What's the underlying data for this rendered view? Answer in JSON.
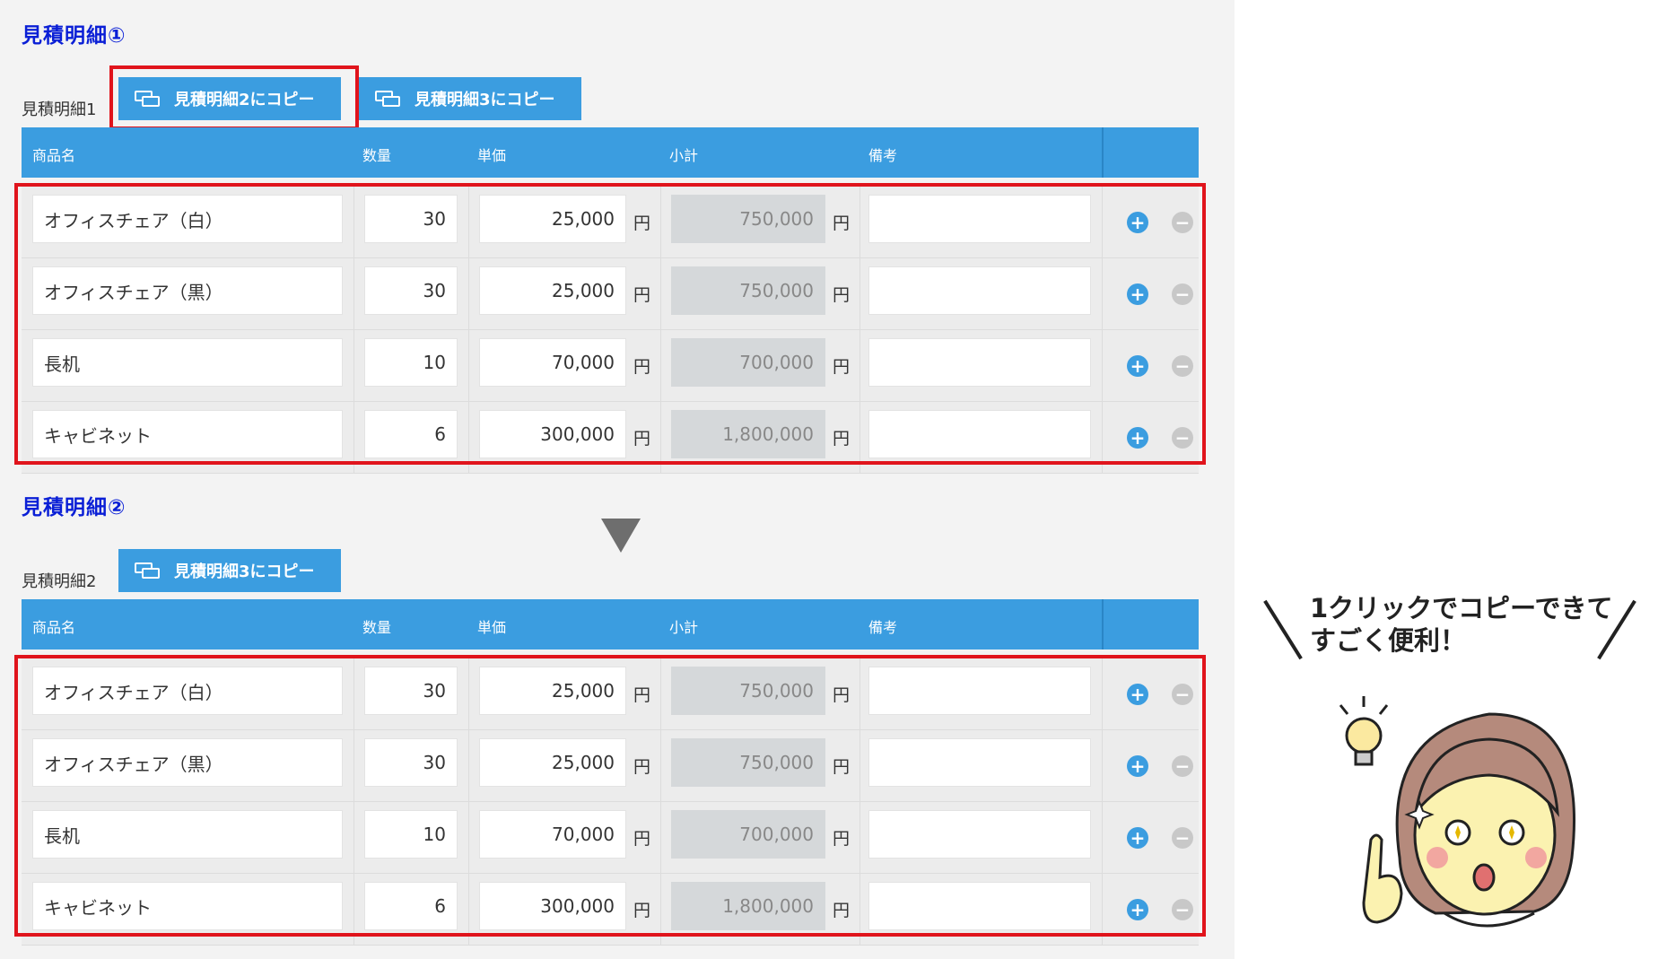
{
  "colors": {
    "accent": "#3b9de0",
    "title": "#0a1fd6",
    "highlight": "#e0141c"
  },
  "sections": [
    {
      "title": "見積明細①",
      "label": "見積明細1",
      "buttons": [
        "見積明細2にコピー",
        "見積明細3にコピー"
      ],
      "headers": [
        "商品名",
        "数量",
        "単価",
        "小計",
        "備考"
      ],
      "currency": "円",
      "rows": [
        {
          "name": "オフィスチェア（白）",
          "qty": "30",
          "price": "25,000",
          "subtotal": "750,000",
          "note": ""
        },
        {
          "name": "オフィスチェア（黒）",
          "qty": "30",
          "price": "25,000",
          "subtotal": "750,000",
          "note": ""
        },
        {
          "name": "長机",
          "qty": "10",
          "price": "70,000",
          "subtotal": "700,000",
          "note": ""
        },
        {
          "name": "キャビネット",
          "qty": "6",
          "price": "300,000",
          "subtotal": "1,800,000",
          "note": ""
        }
      ]
    },
    {
      "title": "見積明細②",
      "label": "見積明細2",
      "buttons": [
        "見積明細3にコピー"
      ],
      "headers": [
        "商品名",
        "数量",
        "単価",
        "小計",
        "備考"
      ],
      "currency": "円",
      "rows": [
        {
          "name": "オフィスチェア（白）",
          "qty": "30",
          "price": "25,000",
          "subtotal": "750,000",
          "note": ""
        },
        {
          "name": "オフィスチェア（黒）",
          "qty": "30",
          "price": "25,000",
          "subtotal": "750,000",
          "note": ""
        },
        {
          "name": "長机",
          "qty": "10",
          "price": "70,000",
          "subtotal": "700,000",
          "note": ""
        },
        {
          "name": "キャビネット",
          "qty": "6",
          "price": "300,000",
          "subtotal": "1,800,000",
          "note": ""
        }
      ]
    }
  ],
  "icons": {
    "add": "plus-circle-icon",
    "remove": "minus-circle-icon",
    "copy": "copy-icon"
  },
  "speech": {
    "line1": "1クリックでコピーできて",
    "line2": "すごく便利！"
  }
}
